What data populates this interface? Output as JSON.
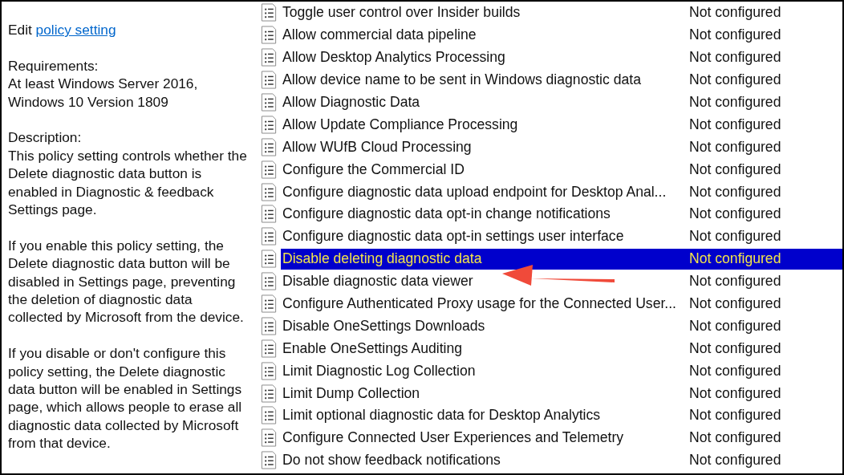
{
  "details": {
    "edit_prefix": "Edit",
    "edit_link": "policy setting",
    "requirements_label": "Requirements:",
    "requirements": "At least Windows Server 2016, Windows 10 Version 1809",
    "description_label": "Description:",
    "paragraphs": [
      "This policy setting controls whether the Delete diagnostic data button is enabled in Diagnostic & feedback Settings page.",
      "If you enable this policy setting, the Delete diagnostic data button will be disabled in Settings page, preventing the deletion of diagnostic data collected by Microsoft from the device.",
      "If you disable or don't configure this policy setting, the Delete diagnostic data button will be enabled in Settings page, which allows people to erase all diagnostic data collected by Microsoft from that device."
    ]
  },
  "settings": [
    {
      "name": "Toggle user control over Insider builds",
      "state": "Not configured",
      "selected": false
    },
    {
      "name": "Allow commercial data pipeline",
      "state": "Not configured",
      "selected": false
    },
    {
      "name": "Allow Desktop Analytics Processing",
      "state": "Not configured",
      "selected": false
    },
    {
      "name": "Allow device name to be sent in Windows diagnostic data",
      "state": "Not configured",
      "selected": false
    },
    {
      "name": "Allow Diagnostic Data",
      "state": "Not configured",
      "selected": false
    },
    {
      "name": "Allow Update Compliance Processing",
      "state": "Not configured",
      "selected": false
    },
    {
      "name": "Allow WUfB Cloud Processing",
      "state": "Not configured",
      "selected": false
    },
    {
      "name": "Configure the Commercial ID",
      "state": "Not configured",
      "selected": false
    },
    {
      "name": "Configure diagnostic data upload endpoint for Desktop Anal...",
      "state": "Not configured",
      "selected": false
    },
    {
      "name": "Configure diagnostic data opt-in change notifications",
      "state": "Not configured",
      "selected": false
    },
    {
      "name": "Configure diagnostic data opt-in settings user interface",
      "state": "Not configured",
      "selected": false
    },
    {
      "name": "Disable deleting diagnostic data",
      "state": "Not configured",
      "selected": true
    },
    {
      "name": "Disable diagnostic data viewer",
      "state": "Not configured",
      "selected": false
    },
    {
      "name": "Configure Authenticated Proxy usage for the Connected User...",
      "state": "Not configured",
      "selected": false
    },
    {
      "name": "Disable OneSettings Downloads",
      "state": "Not configured",
      "selected": false
    },
    {
      "name": "Enable OneSettings Auditing",
      "state": "Not configured",
      "selected": false
    },
    {
      "name": "Limit Diagnostic Log Collection",
      "state": "Not configured",
      "selected": false
    },
    {
      "name": "Limit Dump Collection",
      "state": "Not configured",
      "selected": false
    },
    {
      "name": "Limit optional diagnostic data for Desktop Analytics",
      "state": "Not configured",
      "selected": false
    },
    {
      "name": "Configure Connected User Experiences and Telemetry",
      "state": "Not configured",
      "selected": false
    },
    {
      "name": "Do not show feedback notifications",
      "state": "Not configured",
      "selected": false
    }
  ]
}
